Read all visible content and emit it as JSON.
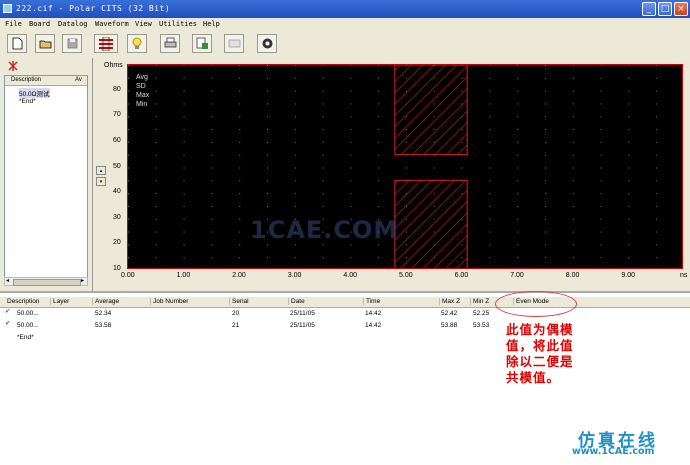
{
  "window": {
    "title": "222.cif - Polar CITS (32 Bit)",
    "minimize": "_",
    "maximize": "□",
    "close": "×"
  },
  "menu": [
    "File",
    "Board",
    "Datalog",
    "Waveform",
    "View",
    "Utilities",
    "Help"
  ],
  "toolbar": [
    "new-icon",
    "open-icon",
    "save-icon",
    "setup-icon",
    "bulb-icon",
    "print-icon",
    "export-icon",
    "blank-icon",
    "help-icon"
  ],
  "left_panel": {
    "col1": "Description",
    "col2": "Av",
    "rows": [
      "50.0Ω测试",
      "*End*"
    ]
  },
  "plot": {
    "y_unit": "Ohms",
    "legend": [
      "Avg",
      "SD",
      "Max",
      "Min"
    ],
    "x_end_label": "ns",
    "watermark": "1CAE.COM"
  },
  "chart_data": {
    "type": "line",
    "xlim": [
      0,
      10
    ],
    "ylim": [
      10,
      90
    ],
    "x_ticks": [
      "0.00",
      "1.00",
      "2.00",
      "3.00",
      "4.00",
      "5.00",
      "6.00",
      "7.00",
      "8.00",
      "9.00"
    ],
    "y_ticks": [
      "10",
      "20",
      "30",
      "40",
      "50",
      "60",
      "70",
      "80"
    ],
    "limit_bands": [
      {
        "x0": 4.8,
        "x1": 6.1,
        "y0": 55,
        "y1": 90
      },
      {
        "x0": 4.8,
        "x1": 6.1,
        "y0": 10,
        "y1": 45
      }
    ],
    "grid": true,
    "legend_position": "top-left"
  },
  "table": {
    "headers": [
      "Description",
      "Layer",
      "Average",
      "Job Number",
      "Serial",
      "Date",
      "Time",
      "Max Z",
      "Min Z",
      "Even Mode"
    ],
    "rows": [
      [
        "50.00...",
        "",
        "52.34",
        "",
        "20",
        "25/11/05",
        "14:42",
        "52.42",
        "52.25"
      ],
      [
        "50.00...",
        "",
        "53.58",
        "",
        "21",
        "25/11/05",
        "14:42",
        "53.88",
        "53.53"
      ]
    ],
    "end_row": "*End*"
  },
  "annotation": {
    "lines": [
      "此值为偶模",
      "值，将此值",
      "除以二便是",
      "共模值。"
    ]
  },
  "logo": {
    "text": "仿真在线",
    "url": "www.1CAE.com"
  },
  "colors": {
    "accent": "#e00000",
    "titlebar": "#1f4fc0"
  }
}
